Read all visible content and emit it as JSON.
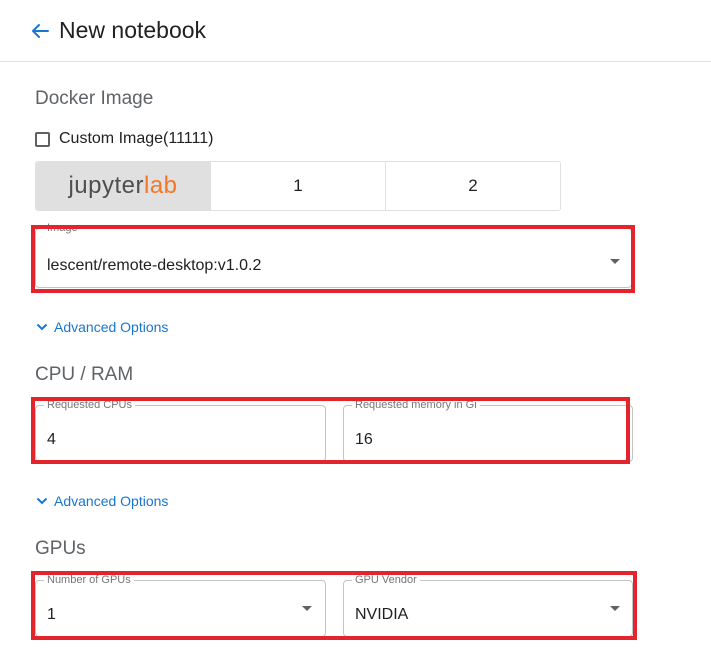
{
  "header": {
    "title": "New notebook",
    "back_icon": "arrow-left-icon"
  },
  "docker": {
    "section_title": "Docker Image",
    "custom_image_label": "Custom Image(11111)",
    "custom_image_checked": false,
    "options": [
      {
        "label": "jupyterlab",
        "logo_part1": "jupyter",
        "logo_part2": "lab",
        "selected": true
      },
      {
        "label": "1",
        "selected": false
      },
      {
        "label": "2",
        "selected": false
      }
    ],
    "image_field": {
      "label": "Image",
      "value": "lescent/remote-desktop:v1.0.2"
    },
    "advanced_label": "Advanced Options"
  },
  "cpu": {
    "section_title": "CPU / RAM",
    "cpus_field": {
      "label": "Requested CPUs",
      "value": "4"
    },
    "memory_field": {
      "label": "Requested memory in Gi",
      "value": "16"
    },
    "advanced_label": "Advanced Options"
  },
  "gpus": {
    "section_title": "GPUs",
    "count_field": {
      "label": "Number of GPUs",
      "value": "1"
    },
    "vendor_field": {
      "label": "GPU Vendor",
      "value": "NVIDIA"
    }
  },
  "colors": {
    "accent": "#1976d2",
    "highlight": "#e3242b",
    "jupyter_orange": "#f37726"
  }
}
